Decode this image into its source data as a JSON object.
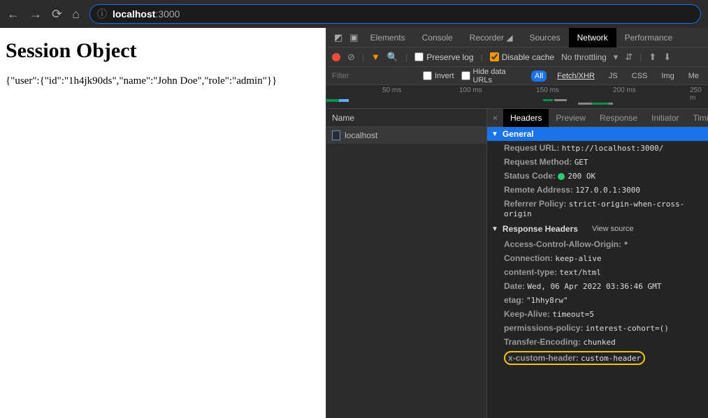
{
  "url": {
    "host": "localhost",
    "port": ":3000"
  },
  "page": {
    "title": "Session Object",
    "body": "{\"user\":{\"id\":\"1h4jk90ds\",\"name\":\"John Doe\",\"role\":\"admin\"}}"
  },
  "tabs": {
    "elements": "Elements",
    "console": "Console",
    "recorder": "Recorder",
    "sources": "Sources",
    "network": "Network",
    "performance": "Performance"
  },
  "toolbar": {
    "preserve": "Preserve log",
    "disable": "Disable cache",
    "throttle": "No throttling"
  },
  "filter": {
    "placeholder": "Filter",
    "invert": "Invert",
    "hide": "Hide data URLs",
    "all": "All",
    "xhr": "Fetch/XHR",
    "js": "JS",
    "css": "CSS",
    "img": "Img",
    "m": "Me"
  },
  "timeline": {
    "t1": "50 ms",
    "t2": "100 ms",
    "t3": "150 ms",
    "t4": "200 ms",
    "t5": "250 m"
  },
  "reqlist": {
    "header": "Name",
    "item": "localhost"
  },
  "detail_tabs": {
    "headers": "Headers",
    "preview": "Preview",
    "response": "Response",
    "initiator": "Initiator",
    "timing": "Timing"
  },
  "general": {
    "title": "General",
    "url_k": "Request URL:",
    "url_v": "http://localhost:3000/",
    "method_k": "Request Method:",
    "method_v": "GET",
    "status_k": "Status Code:",
    "status_v": "200 OK",
    "remote_k": "Remote Address:",
    "remote_v": "127.0.0.1:3000",
    "ref_k": "Referrer Policy:",
    "ref_v": "strict-origin-when-cross-origin"
  },
  "resp": {
    "title": "Response Headers",
    "viewsrc": "View source",
    "acao_k": "Access-Control-Allow-Origin:",
    "acao_v": "*",
    "conn_k": "Connection:",
    "conn_v": "keep-alive",
    "ct_k": "content-type:",
    "ct_v": "text/html",
    "date_k": "Date:",
    "date_v": "Wed, 06 Apr 2022 03:36:46 GMT",
    "etag_k": "etag:",
    "etag_v": "\"1hhy8rw\"",
    "ka_k": "Keep-Alive:",
    "ka_v": "timeout=5",
    "pp_k": "permissions-policy:",
    "pp_v": "interest-cohort=()",
    "te_k": "Transfer-Encoding:",
    "te_v": "chunked",
    "xc_k": "x-custom-header:",
    "xc_v": "custom-header"
  }
}
